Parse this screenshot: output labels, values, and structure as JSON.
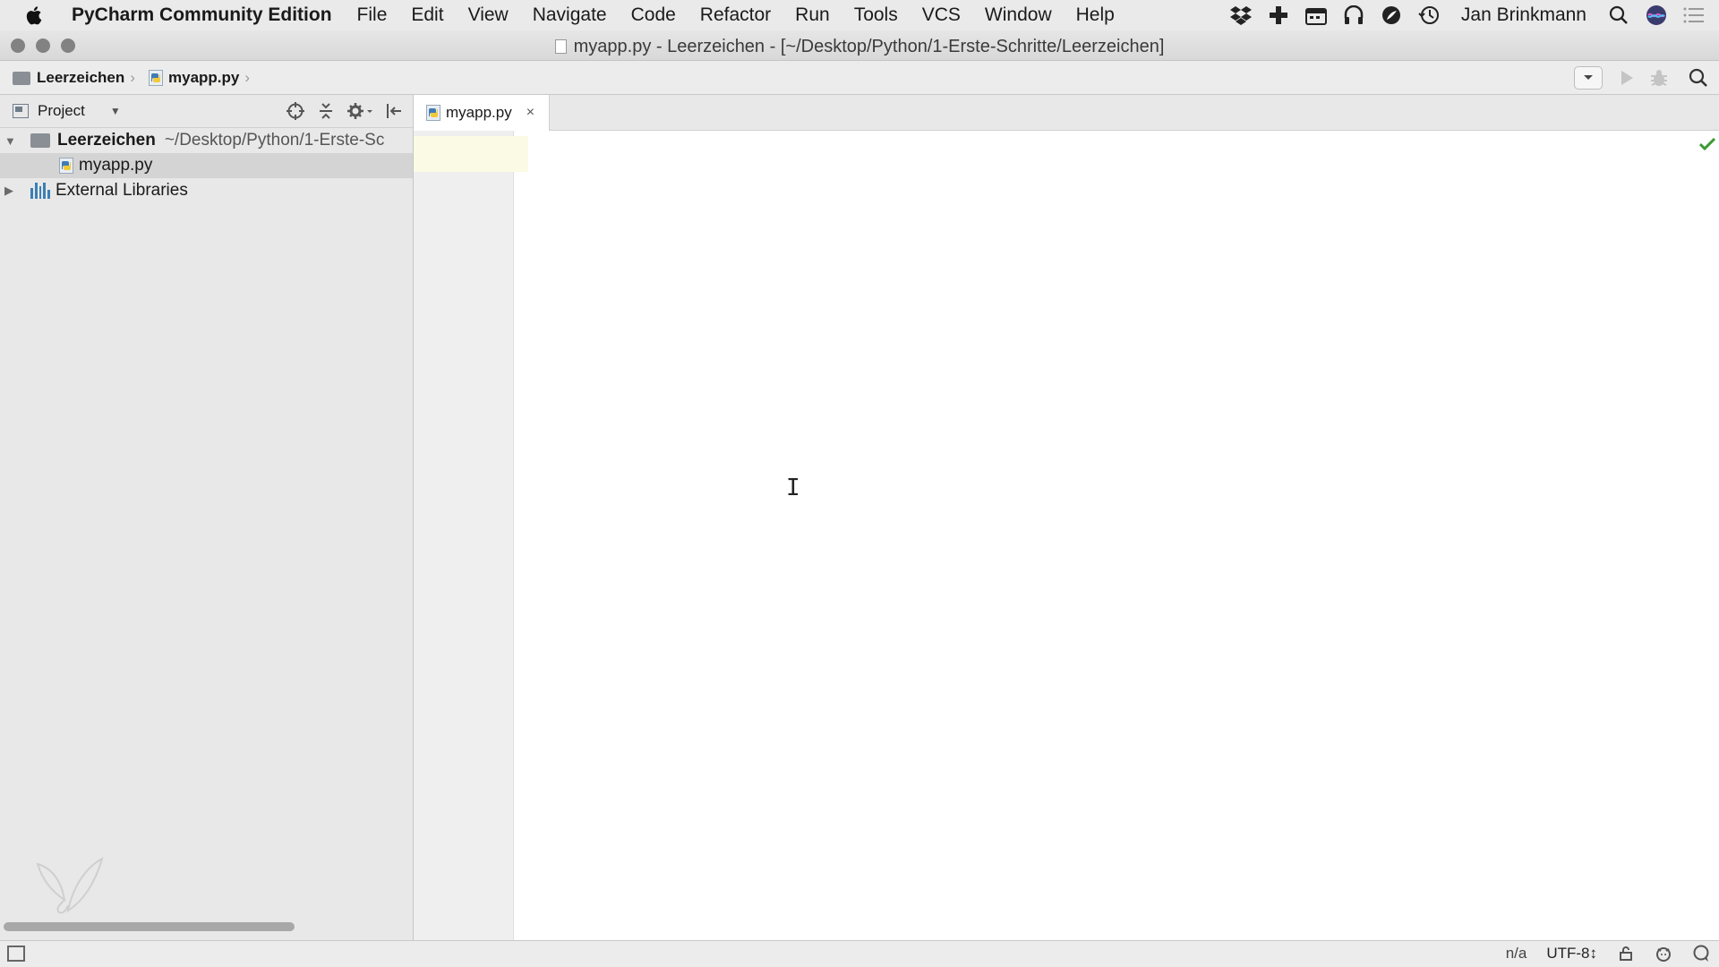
{
  "menubar": {
    "app_name": "PyCharm Community Edition",
    "items": [
      "File",
      "Edit",
      "View",
      "Navigate",
      "Code",
      "Refactor",
      "Run",
      "Tools",
      "VCS",
      "Window",
      "Help"
    ],
    "user": "Jan Brinkmann",
    "status_icons": [
      "dropbox-icon",
      "plus-cross-icon",
      "calendar-icon",
      "headphones-icon",
      "leaf-icon",
      "time-machine-icon",
      "spotlight-search-icon",
      "siri-icon",
      "notification-center-icon"
    ]
  },
  "window": {
    "title": "myapp.py - Leerzeichen - [~/Desktop/Python/1-Erste-Schritte/Leerzeichen]"
  },
  "navbar": {
    "breadcrumb_project": "Leerzeichen",
    "breadcrumb_file": "myapp.py"
  },
  "project_pane": {
    "view_label": "Project",
    "tree": {
      "root_name": "Leerzeichen",
      "root_path": "~/Desktop/Python/1-Erste-Sc",
      "file": "myapp.py",
      "external": "External Libraries"
    }
  },
  "editor": {
    "tab_label": "myapp.py",
    "tab_close": "×"
  },
  "statusbar": {
    "position": "n/a",
    "encoding": "UTF-8↕"
  },
  "colors": {
    "accent_check": "#3c9a34",
    "caret_line": "#fbfbe5",
    "selection": "#d4d4d4"
  }
}
